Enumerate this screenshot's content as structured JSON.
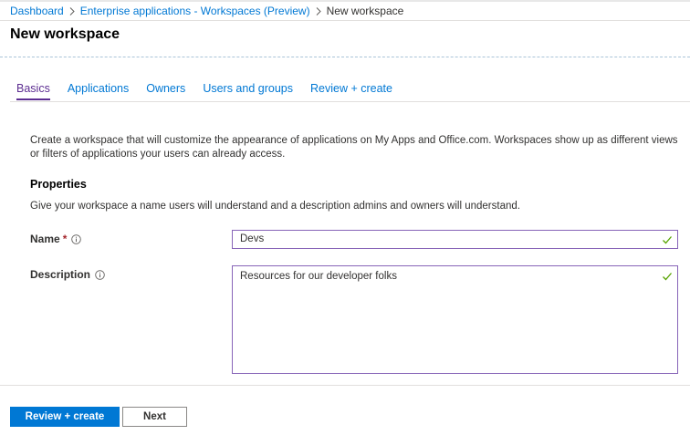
{
  "breadcrumb": {
    "items": [
      "Dashboard",
      "Enterprise applications - Workspaces (Preview)"
    ],
    "current": "New workspace"
  },
  "page": {
    "title": "New workspace"
  },
  "tabs": [
    {
      "label": "Basics",
      "active": true
    },
    {
      "label": "Applications",
      "active": false
    },
    {
      "label": "Owners",
      "active": false
    },
    {
      "label": "Users and groups",
      "active": false
    },
    {
      "label": "Review + create",
      "active": false
    }
  ],
  "intro": "Create a workspace that will customize the appearance of applications on My Apps and Office.com. Workspaces show up as different views or filters of applications your users can already access.",
  "properties": {
    "heading": "Properties",
    "description": "Give your workspace a name users will understand and a description admins and owners will understand."
  },
  "form": {
    "name": {
      "label": "Name",
      "required_marker": "*",
      "value": "Devs",
      "valid": true
    },
    "description": {
      "label": "Description",
      "value": "Resources for our developer folks",
      "valid": true
    }
  },
  "footer": {
    "primary_label": "Review + create",
    "secondary_label": "Next"
  },
  "colors": {
    "accent": "#0078d4",
    "active_tab": "#5c2d91",
    "field_border": "#8764b8",
    "valid_check": "#57a300",
    "required": "#a4262c"
  },
  "icons": {
    "info": "info-icon",
    "check": "checkmark-icon",
    "separator": "chevron-right-icon"
  }
}
